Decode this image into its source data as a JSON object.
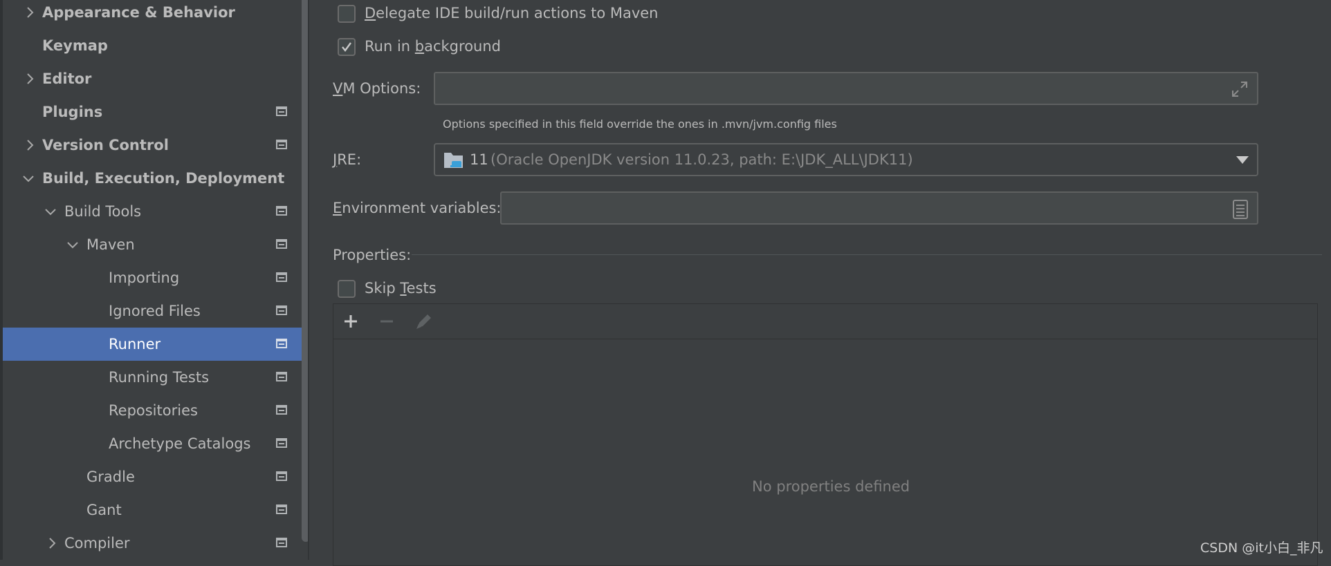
{
  "sidebar": {
    "items": [
      {
        "label": "Appearance & Behavior",
        "bold": true,
        "chevron": "right"
      },
      {
        "label": "Keymap",
        "bold": true,
        "chevron": "none"
      },
      {
        "label": "Editor",
        "bold": true,
        "chevron": "right"
      },
      {
        "label": "Plugins",
        "bold": true,
        "chevron": "none",
        "project_icon": true
      },
      {
        "label": "Version Control",
        "bold": true,
        "chevron": "right",
        "project_icon": true
      },
      {
        "label": "Build, Execution, Deployment",
        "bold": true,
        "chevron": "down"
      },
      {
        "label": "Build Tools",
        "bold": false,
        "chevron": "down",
        "project_icon": true
      },
      {
        "label": "Maven",
        "bold": false,
        "chevron": "down",
        "project_icon": true
      },
      {
        "label": "Importing",
        "bold": false,
        "chevron": "none",
        "project_icon": true
      },
      {
        "label": "Ignored Files",
        "bold": false,
        "chevron": "none",
        "project_icon": true
      },
      {
        "label": "Runner",
        "bold": false,
        "chevron": "none",
        "project_icon": true,
        "selected": true
      },
      {
        "label": "Running Tests",
        "bold": false,
        "chevron": "none",
        "project_icon": true
      },
      {
        "label": "Repositories",
        "bold": false,
        "chevron": "none",
        "project_icon": true
      },
      {
        "label": "Archetype Catalogs",
        "bold": false,
        "chevron": "none",
        "project_icon": true
      },
      {
        "label": "Gradle",
        "bold": false,
        "chevron": "none",
        "project_icon": true
      },
      {
        "label": "Gant",
        "bold": false,
        "chevron": "none",
        "project_icon": true
      },
      {
        "label": "Compiler",
        "bold": false,
        "chevron": "right",
        "project_icon": true
      }
    ]
  },
  "runner": {
    "delegate": {
      "mnemonic": "D",
      "rest": "elegate IDE build/run actions to Maven",
      "checked": false
    },
    "background": {
      "pre": "Run in ",
      "mnemonic": "b",
      "rest": "ackground",
      "checked": true
    },
    "vm_options": {
      "mnemonic": "V",
      "rest": "M Options:",
      "value": "",
      "hint": "Options specified in this field override the ones in .mvn/jvm.config files"
    },
    "jre": {
      "mnemonic": "J",
      "rest": "RE:",
      "version": "11",
      "detail": "(Oracle OpenJDK version 11.0.23, path: E:\\JDK_ALL\\JDK11)"
    },
    "env": {
      "mnemonic": "E",
      "rest": "nvironment variables:",
      "value": ""
    },
    "properties": {
      "label": "Properties:",
      "empty_text": "No properties defined"
    },
    "skip_tests": {
      "pre": "Skip ",
      "mnemonic": "T",
      "rest": "ests",
      "checked": false
    }
  },
  "icons": {
    "chevron_right": "chevron-right-icon",
    "chevron_down": "chevron-down-icon",
    "project": "project-settings-icon",
    "expand": "expand-icon",
    "folder": "folder-icon",
    "dropdown": "dropdown-arrow-icon",
    "list": "list-icon",
    "add": "plus-icon",
    "remove": "minus-icon",
    "edit": "pencil-icon"
  },
  "colors": {
    "selection": "#4b6eaf",
    "background": "#3c3f41",
    "text": "#bbbbbb"
  },
  "watermark": "CSDN @it小白_非凡"
}
